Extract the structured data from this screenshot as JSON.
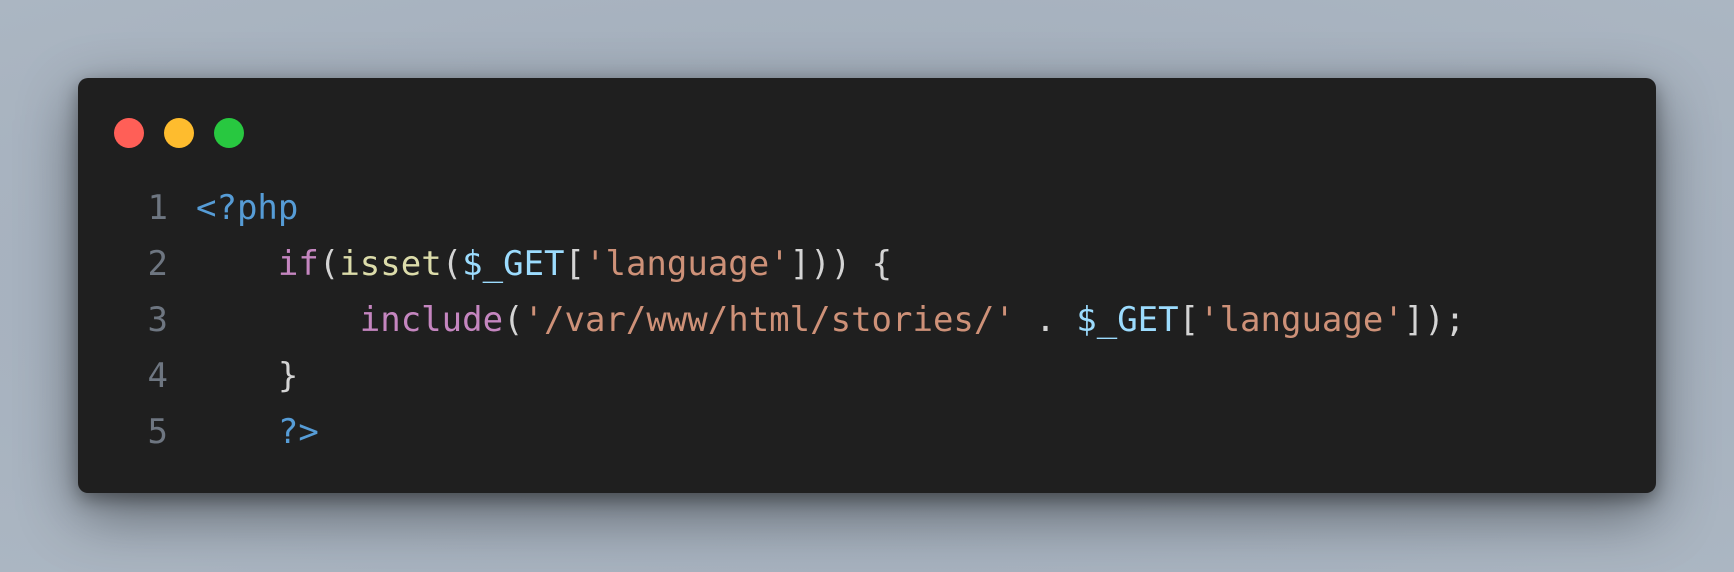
{
  "window": {
    "controls": [
      {
        "name": "close",
        "color": "#ff5f57"
      },
      {
        "name": "minimize",
        "color": "#febc2e"
      },
      {
        "name": "maximize",
        "color": "#28c840"
      }
    ]
  },
  "code": {
    "language": "php",
    "lines": [
      {
        "number": "1",
        "indent": "",
        "tokens": [
          {
            "text": "<?php",
            "type": "tag"
          }
        ]
      },
      {
        "number": "2",
        "indent": "    ",
        "tokens": [
          {
            "text": "if",
            "type": "kw"
          },
          {
            "text": "(",
            "type": "punc"
          },
          {
            "text": "isset",
            "type": "fn"
          },
          {
            "text": "(",
            "type": "punc"
          },
          {
            "text": "$_GET",
            "type": "var"
          },
          {
            "text": "[",
            "type": "punc"
          },
          {
            "text": "'language'",
            "type": "str"
          },
          {
            "text": "])) {",
            "type": "punc"
          }
        ]
      },
      {
        "number": "3",
        "indent": "        ",
        "tokens": [
          {
            "text": "include",
            "type": "kw"
          },
          {
            "text": "(",
            "type": "punc"
          },
          {
            "text": "'/var/www/html/stories/'",
            "type": "str"
          },
          {
            "text": " . ",
            "type": "punc"
          },
          {
            "text": "$_GET",
            "type": "var"
          },
          {
            "text": "[",
            "type": "punc"
          },
          {
            "text": "'language'",
            "type": "str"
          },
          {
            "text": "]);",
            "type": "punc"
          }
        ]
      },
      {
        "number": "4",
        "indent": "    ",
        "tokens": [
          {
            "text": "}",
            "type": "punc"
          }
        ]
      },
      {
        "number": "5",
        "indent": "    ",
        "tokens": [
          {
            "text": "?>",
            "type": "tag"
          }
        ]
      }
    ]
  }
}
